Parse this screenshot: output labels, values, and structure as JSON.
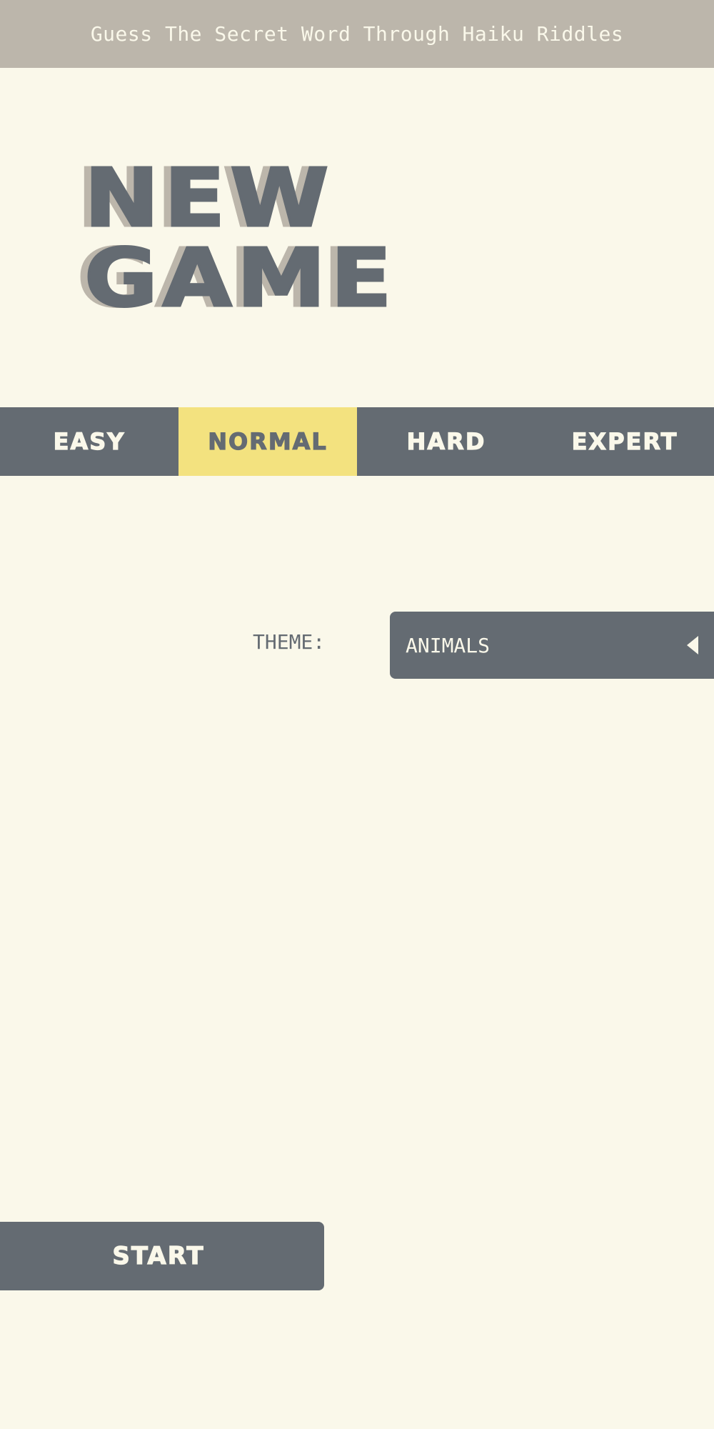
{
  "header": {
    "tagline": "Guess The Secret Word Through Haiku Riddles"
  },
  "title": {
    "line1": "NEW",
    "line2": "GAME"
  },
  "difficulty": {
    "options": [
      {
        "label": "EASY",
        "selected": false
      },
      {
        "label": "NORMAL",
        "selected": true
      },
      {
        "label": "HARD",
        "selected": false
      },
      {
        "label": "EXPERT",
        "selected": false
      }
    ]
  },
  "theme": {
    "label": "THEME:",
    "value": "ANIMALS",
    "caret_icon": "caret-left-icon"
  },
  "start_button": {
    "label": "START"
  },
  "colors": {
    "background": "#faf8ea",
    "banner": "#bcb6ab",
    "primary": "#646b72",
    "accent": "#f3e27f",
    "text_light": "#faf8ea"
  }
}
